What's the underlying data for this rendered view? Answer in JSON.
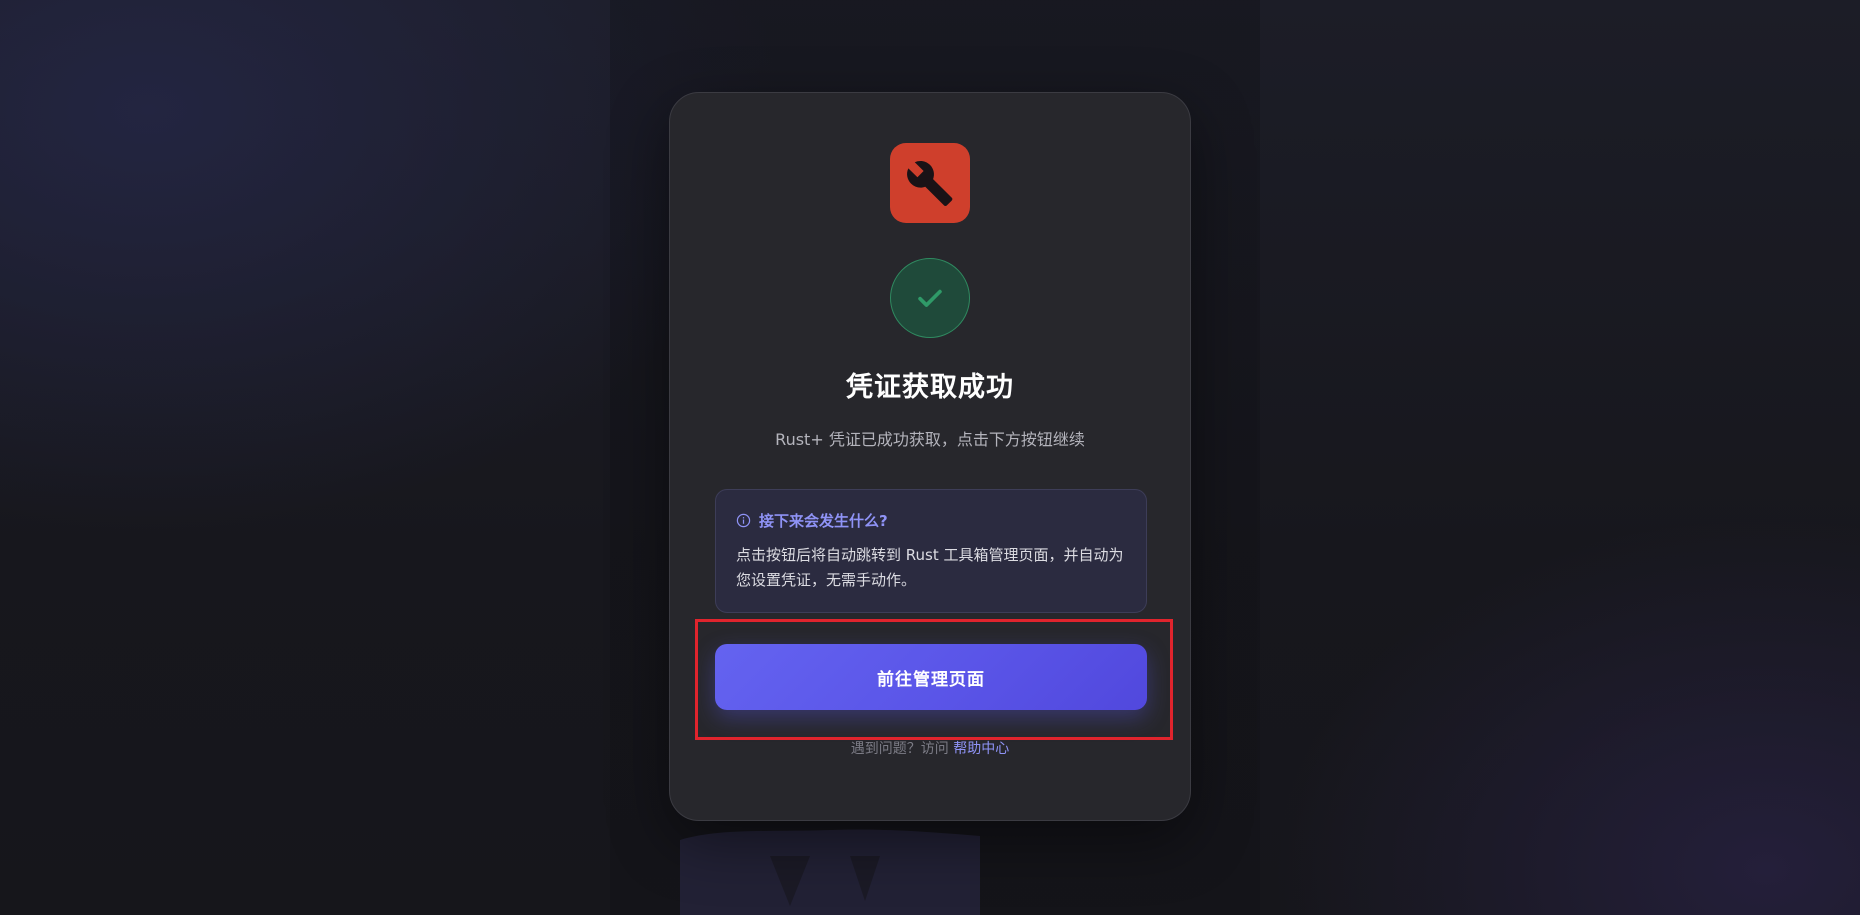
{
  "card": {
    "app_icon": "wrench-icon",
    "status_icon": "checkmark-icon",
    "title": "凭证获取成功",
    "subtitle": "Rust+ 凭证已成功获取，点击下方按钮继续",
    "info": {
      "icon": "info-icon",
      "heading": "接下来会发生什么?",
      "body": "点击按钮后将自动跳转到 Rust 工具箱管理页面，并自动为您设置凭证，无需手动作。"
    },
    "primary_button_label": "前往管理页面",
    "help": {
      "prefix": "遇到问题？访问",
      "link_label": "帮助中心"
    }
  },
  "colors": {
    "app_icon_bg": "#cf3f2c",
    "success_green": "#2f8a60",
    "accent": "#5a55e8",
    "highlight": "#e0242d"
  }
}
